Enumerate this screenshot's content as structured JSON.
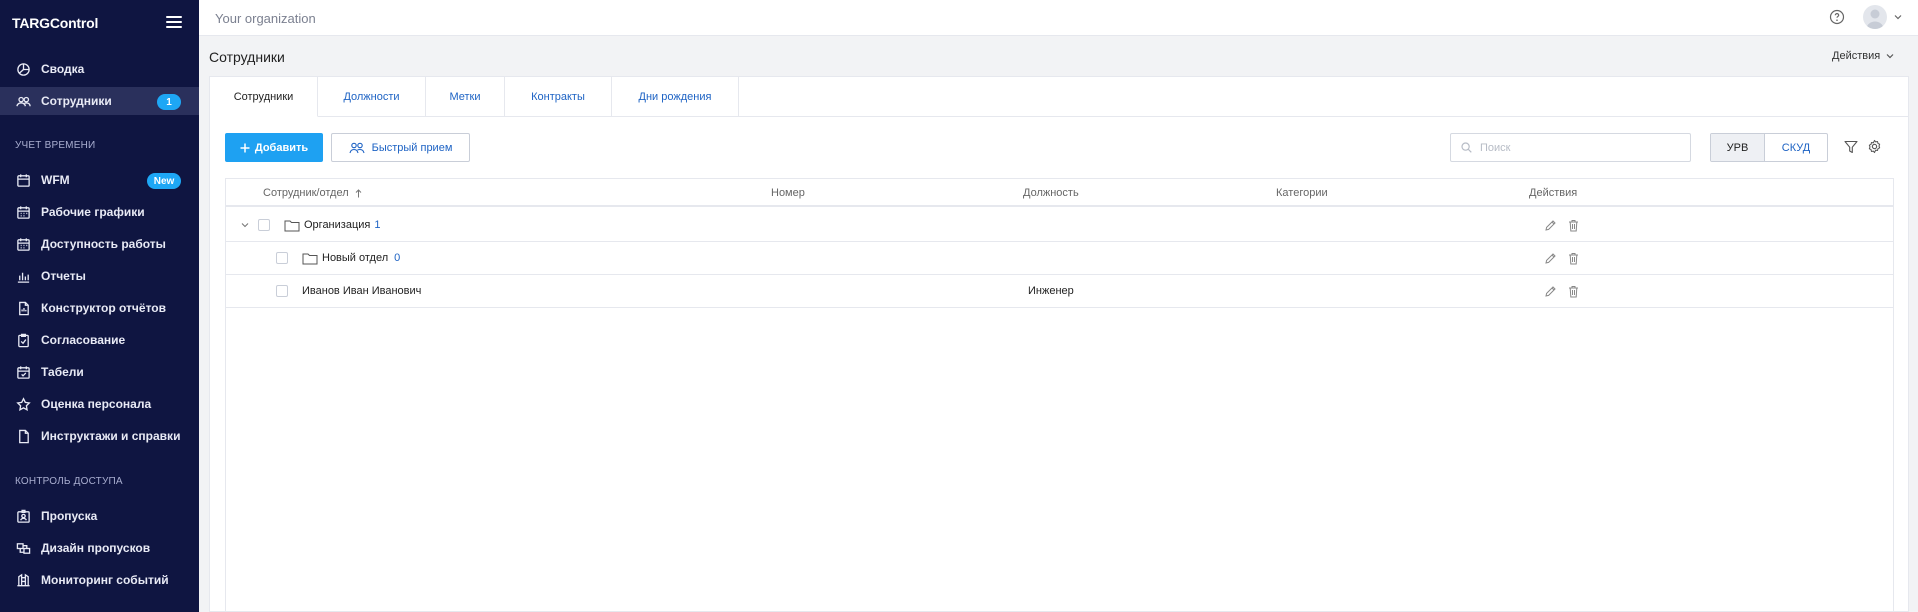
{
  "app": {
    "brand": "TARGControl",
    "org_name": "Your organization"
  },
  "sidebar": {
    "items_top": [
      {
        "label": "Сводка",
        "icon": "dashboard-icon"
      },
      {
        "label": "Сотрудники",
        "icon": "users-icon",
        "badge": "1",
        "active": true
      }
    ],
    "section_time": "УЧЕТ ВРЕМЕНИ",
    "items_time": [
      {
        "label": "WFM",
        "icon": "calendar-icon",
        "badge": "New"
      },
      {
        "label": "Рабочие графики",
        "icon": "calendar-grid-icon"
      },
      {
        "label": "Доступность работы",
        "icon": "calendar-grid-icon"
      },
      {
        "label": "Отчеты",
        "icon": "bar-chart-icon"
      },
      {
        "label": "Конструктор отчётов",
        "icon": "report-builder-icon"
      },
      {
        "label": "Согласование",
        "icon": "approval-icon"
      },
      {
        "label": "Табели",
        "icon": "timesheet-icon"
      },
      {
        "label": "Оценка персонала",
        "icon": "star-icon"
      },
      {
        "label": "Инструктажи и справки",
        "icon": "document-icon"
      }
    ],
    "section_access": "КОНТРОЛЬ ДОСТУПА",
    "items_access": [
      {
        "label": "Пропуска",
        "icon": "badge-icon"
      },
      {
        "label": "Дизайн пропусков",
        "icon": "badge-design-icon"
      },
      {
        "label": "Мониторинг событий",
        "icon": "monitoring-icon"
      }
    ]
  },
  "page": {
    "title": "Сотрудники",
    "actions_label": "Действия"
  },
  "tabs": [
    "Сотрудники",
    "Должности",
    "Метки",
    "Контракты",
    "Дни рождения"
  ],
  "toolbar": {
    "add_label": "Добавить",
    "quick_label": "Быстрый прием",
    "search_placeholder": "Поиск",
    "seg_on": "УРВ",
    "seg_off": "СКУД"
  },
  "table": {
    "columns": [
      "Сотрудник/отдел",
      "Номер",
      "Должность",
      "Категории",
      "Действия"
    ],
    "rows": [
      {
        "name": "Организация",
        "count": "1",
        "position": ""
      },
      {
        "name": "Новый отдел",
        "count": "0",
        "position": ""
      },
      {
        "name": "Иванов Иван Иванович",
        "count": "",
        "position": "Инженер"
      }
    ]
  },
  "colors": {
    "sidebar_bg": "#0f1541",
    "accent": "#1ea1f2",
    "link": "#1e63c4"
  }
}
